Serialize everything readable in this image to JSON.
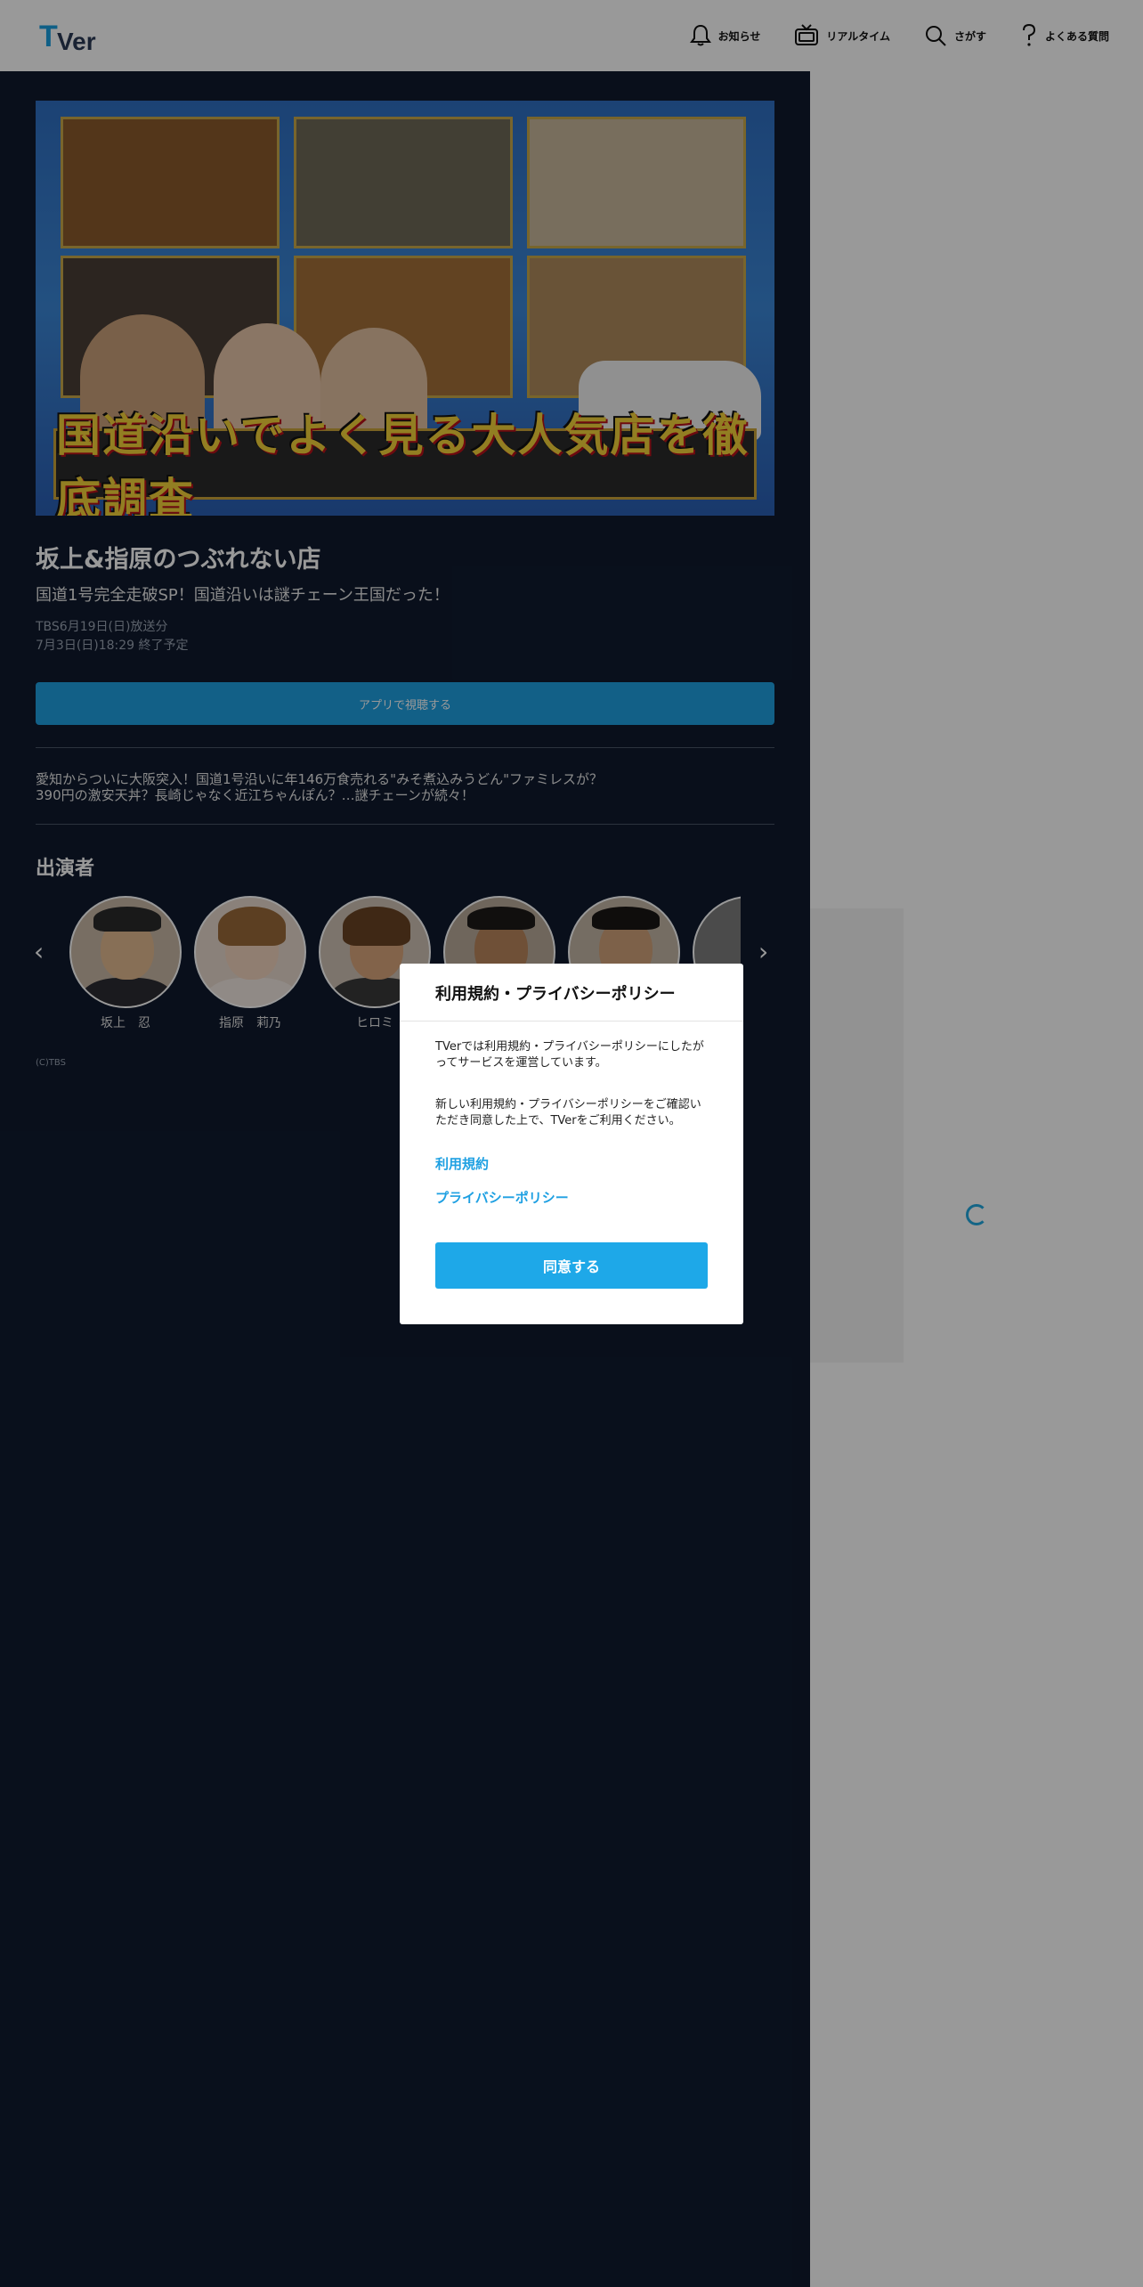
{
  "header": {
    "logo_text": "TVer",
    "nav": [
      {
        "icon": "bell-icon",
        "label": "お知らせ"
      },
      {
        "icon": "tv-icon",
        "label": "リアルタイム"
      },
      {
        "icon": "search-icon",
        "label": "さがす"
      },
      {
        "icon": "question-icon",
        "label": "よくある質問"
      }
    ]
  },
  "episode": {
    "hero_caption": "国道沿いでよく見る大人気店を徹底調査",
    "title": "坂上&指原のつぶれない店",
    "subtitle": "国道1号完全走破SP！国道沿いは謎チェーン王国だった！",
    "broadcast": "TBS6月19日(日)放送分",
    "expiry": "7月3日(日)18:29 終了予定",
    "app_button_label": "アプリで視聴する",
    "description_line1": "愛知からついに大阪突入！国道1号沿いに年146万食売れる\"みそ煮込みうどん\"ファミレスが？",
    "description_line2": "390円の激安天丼？長崎じゃなく近江ちゃんぽん？…謎チェーンが続々！"
  },
  "cast": {
    "heading": "出演者",
    "members": [
      "坂上　忍",
      "指原　莉乃",
      "ヒロミ",
      "",
      "",
      ""
    ]
  },
  "copyright": "(C)TBS",
  "modal": {
    "title": "利用規約・プライバシーポリシー",
    "text1": "TVerでは利用規約・プライバシーポリシーにしたがってサービスを運営しています。",
    "text2": "新しい利用規約・プライバシーポリシーをご確認いただき同意した上で、TVerをご利用ください。",
    "link_terms": "利用規約",
    "link_privacy": "プライバシーポリシー",
    "agree_label": "同意する"
  },
  "colors": {
    "accent": "#1ea0e2",
    "panel": "#0f1a2e"
  }
}
